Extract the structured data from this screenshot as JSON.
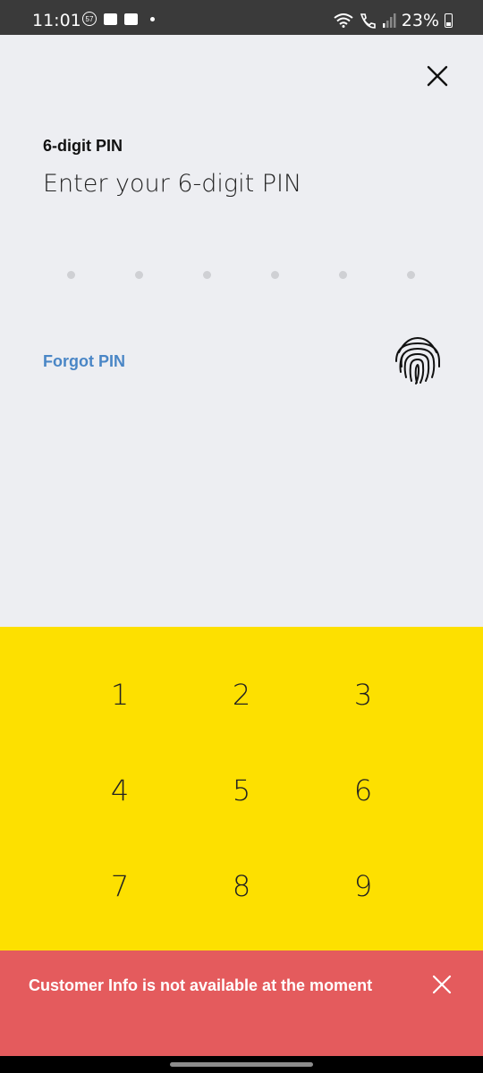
{
  "status_bar": {
    "time": "11:01",
    "notification_badge": "57",
    "battery": "23%",
    "icons": [
      "notification-badge-icon",
      "gallery-icon",
      "mail-icon",
      "dot-icon",
      "wifi-icon",
      "call-icon",
      "signal-icon",
      "battery-icon"
    ]
  },
  "header": {
    "close_icon": "close-icon"
  },
  "pin": {
    "label": "6-digit PIN",
    "title": "Enter your 6-digit PIN",
    "entered_digits": 0,
    "total_digits": 6
  },
  "actions": {
    "forgot_pin": "Forgot PIN",
    "fingerprint_icon": "fingerprint-icon"
  },
  "keypad": {
    "keys": [
      "1",
      "2",
      "3",
      "4",
      "5",
      "6",
      "7",
      "8",
      "9"
    ]
  },
  "toast": {
    "message": "Customer Info is not available at the moment",
    "close_icon": "close-icon"
  },
  "colors": {
    "background": "#edeef2",
    "keypad": "#fde000",
    "toast": "#e45b5d",
    "link": "#4a86c6"
  }
}
